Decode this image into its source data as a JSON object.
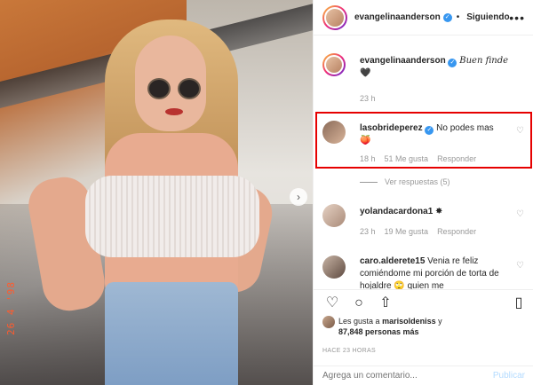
{
  "photo": {
    "date_stamp": "26 4 '98"
  },
  "header": {
    "username": "evangelinaanderson",
    "verified": "✓",
    "separator": "•",
    "follow_status": "Siguiendo",
    "more": "•••"
  },
  "comments": [
    {
      "username": "evangelinaanderson",
      "verified": "✓",
      "text": "Buen finde",
      "emoji": "🖤",
      "time": "23 h"
    },
    {
      "username": "lasobrideperez",
      "verified": "✓",
      "text": "No podes mas",
      "emoji": "🍑",
      "time": "18 h",
      "likes": "51 Me gusta",
      "reply": "Responder"
    },
    {
      "view_replies": "Ver respuestas (5)"
    },
    {
      "username": "yolandacardona1",
      "emoji": "✸",
      "time": "23 h",
      "likes": "19 Me gusta",
      "reply": "Responder"
    },
    {
      "username": "caro.alderete15",
      "text": "Venia re feliz comiéndome mi porción de torta de hojaldre 🙄 quien me"
    }
  ],
  "actions": {
    "like": "like-icon",
    "comment": "comment-icon",
    "share": "share-icon",
    "save": "save-icon"
  },
  "likes": {
    "line1_prefix": "Les gusta a",
    "line1_user": "marisoldeniss",
    "line1_suffix": "y",
    "line2": "87,848 personas más"
  },
  "timestamp": "HACE 23 HORAS",
  "add_comment": {
    "placeholder": "Agrega un comentario...",
    "publish": "Publicar"
  },
  "colors": {
    "verified": "#3897f0",
    "highlight": "#e60000",
    "publish": "#b3dbff"
  }
}
